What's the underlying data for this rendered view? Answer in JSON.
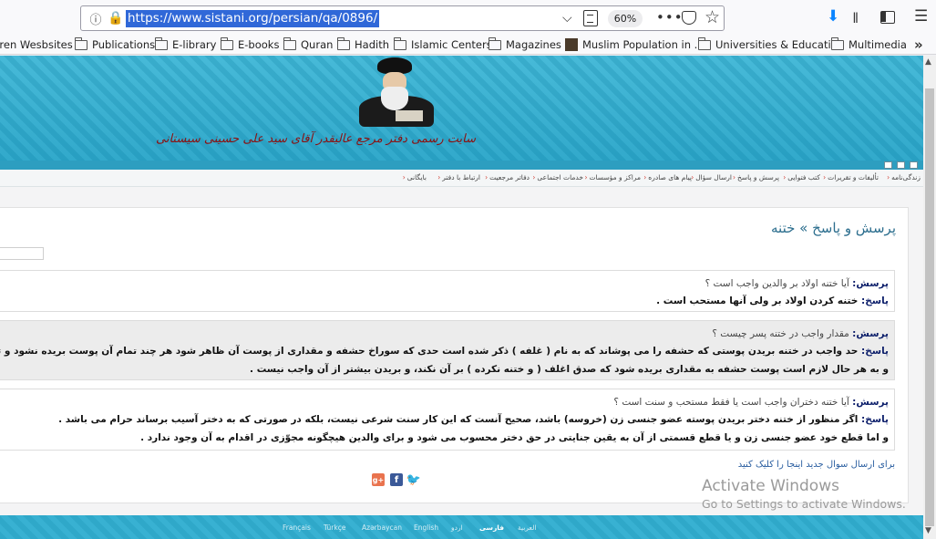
{
  "browser": {
    "url": "https://www.sistani.org/persian/qa/0896/",
    "zoom": "60%",
    "info_icon": "info-icon",
    "lock_icon": "lock-icon"
  },
  "bookmarks": [
    {
      "label": "Iren Wesbsites",
      "icon": "none"
    },
    {
      "label": "Publications",
      "icon": "folder-icon"
    },
    {
      "label": "E-library",
      "icon": "folder-icon"
    },
    {
      "label": "E-books",
      "icon": "folder-icon"
    },
    {
      "label": "Quran",
      "icon": "folder-icon"
    },
    {
      "label": "Hadith",
      "icon": "folder-icon"
    },
    {
      "label": "Islamic Centers",
      "icon": "folder-icon"
    },
    {
      "label": "Magazines",
      "icon": "folder-icon"
    },
    {
      "label": "Muslim Population in ...",
      "icon": "thumbnail-icon"
    },
    {
      "label": "Universities & Educati...",
      "icon": "folder-icon"
    },
    {
      "label": "Multimedia",
      "icon": "folder-icon"
    }
  ],
  "site": {
    "banner_title": "سایت رسمی دفتر مرجع عالیقدر آقای سید علی حسینی سیستانی",
    "nav": [
      "زندگی‌نامه",
      "تألیفات و تقریرات",
      "کتب فتوایی",
      "پرسش و پاسخ",
      "ارسال سؤال",
      "پیام های صادره",
      "مراکز و مؤسسات",
      "خدمات اجتماعی",
      "دفاتر مرجعیت",
      "ارتباط با دفتر",
      "بایگانی"
    ],
    "page_title": "پرسش و پاسخ » ختنه",
    "qa": [
      {
        "q_label": "پرسش:",
        "q": "آیا ختنه اولاد بر والدین واجب است ؟",
        "a_label": "پاسخ:",
        "a": [
          "ختنه کردن اولاد بر ولی آنها مستحب است ."
        ]
      },
      {
        "q_label": "پرسش:",
        "q": "مقدار واجب در ختنه پسر چیست ؟",
        "a_label": "پاسخ:",
        "a": [
          "حد واجب در ختنه بریدن پوستی که حشفه را می پوشاند که به نام ( غلفه ) ذکر شده است حدی که سوراخ حشفه و مقداری از پوست آن ظاهر شود هر چند تمام آن پوست بریده نشود و تمام حشفه ظاهر نشود",
          "و به هر حال لازم است پوست حشفه به مقداری بریده شود که صدق اغلف ( و ختنه نکرده ) بر آن نکند، و بریدن بیشتر از آن واجب نیست ."
        ]
      },
      {
        "q_label": "پرسش:",
        "q": "آیا ختنه دختران واجب است یا فقط مستحب و سنت است ؟",
        "a_label": "پاسخ:",
        "a": [
          "اگر منظور از ختنه دختر بریدن پوسته عضو جنسی زن (خروسه) باشد، صحیح آنست که این کار سنت شرعی نیست، بلکه در صورتی که به دختر آسیب برساند حرام می باشد .",
          "و اما قطع خود عضو جنسی زن و یا قطع قسمتی از آن به یقین جنایتی در حق دختر محسوب می شود و برای والدین هیچگونه مجوّزی در اقدام به آن وجود ندارد ."
        ]
      }
    ],
    "submit_link": "برای ارسال سوال جدید اینجا را کلیک کنید",
    "share": {
      "gplus": "g+",
      "facebook": "f",
      "twitter": "🐦"
    },
    "languages": [
      "Français",
      "Türkçe",
      "Azərbaycan",
      "English",
      "اردو",
      "فارسی",
      "العربية"
    ],
    "active_language": "فارسی"
  },
  "watermark": {
    "line1": "Activate Windows",
    "line2": "Go to Settings to activate Windows."
  },
  "colors": {
    "banner": "#2fa8c9",
    "url_highlight": "#3068d8",
    "label": "#0d1f6b",
    "title": "#2c6e8e"
  }
}
